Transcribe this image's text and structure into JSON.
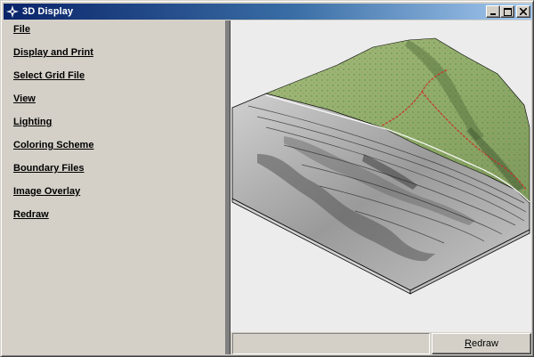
{
  "window": {
    "title": "3D Display",
    "icon": "compass-icon",
    "controls": [
      "minimize-icon",
      "maximize-icon",
      "close-icon"
    ]
  },
  "menu": {
    "items": [
      {
        "label": "File"
      },
      {
        "label": "Display and Print"
      },
      {
        "label": "Select Grid File"
      },
      {
        "label": "View"
      },
      {
        "label": "Lighting"
      },
      {
        "label": "Coloring Scheme"
      },
      {
        "label": "Boundary Files"
      },
      {
        "label": "Image Overlay"
      },
      {
        "label": "Redraw"
      }
    ]
  },
  "footer": {
    "status_text": "",
    "redraw_label": "Redraw"
  },
  "colors": {
    "title_gradient_start": "#0a246a",
    "title_gradient_end": "#a6caf0",
    "face": "#d4d0c8",
    "view_background": "#ececec",
    "splitter": "#808080",
    "terrain_green": "#8fae6a",
    "terrain_gray": "#b8b8b8"
  }
}
